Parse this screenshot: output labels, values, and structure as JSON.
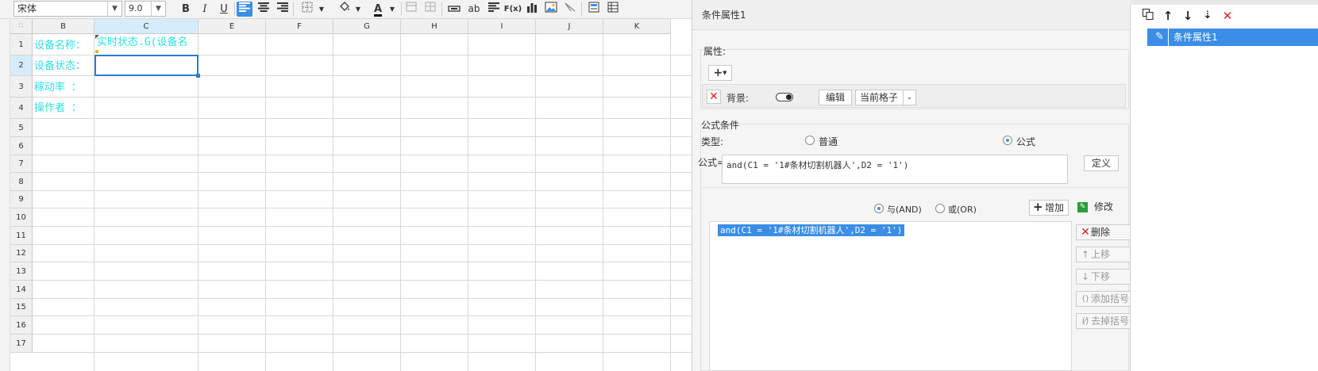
{
  "toolbar": {
    "font_family": "宋体",
    "font_size": "9.0",
    "bold": "B",
    "italic": "I",
    "underline": "U",
    "text_ab": "ab",
    "formula_btn": "F(x)"
  },
  "sheet": {
    "columns": [
      "B",
      "C",
      "E",
      "F",
      "G",
      "H",
      "I",
      "J",
      "K"
    ],
    "selected_column": "C",
    "rows": [
      "1",
      "2",
      "3",
      "4",
      "5",
      "6",
      "7",
      "8",
      "9",
      "10",
      "11",
      "12",
      "13",
      "14",
      "15",
      "16",
      "17"
    ],
    "selected_row": "2",
    "cells": {
      "b1": "设备名称：",
      "b2": "设备状态：",
      "b3": "稼动率 ：",
      "b4": "操作者 ：",
      "c1": "实时状态.G(设备名"
    }
  },
  "panel": {
    "title": "条件属性1",
    "attr_label": "属性:",
    "background_label": "背景:",
    "edit_label": "编辑",
    "scope_value": "当前格子",
    "formula_section": "公式条件",
    "type_label": "类型:",
    "type_normal": "普通",
    "type_formula": "公式",
    "formula_label": "公式=",
    "formula_value": "and(C1 = '1#条材切割机器人',D2 = '1')",
    "define_label": "定义",
    "and_label": "与(AND)",
    "or_label": "或(OR)",
    "add_label": "增加",
    "modify_label": "修改",
    "condition_item": "and(C1 = '1#条材切割机器人',D2 = '1')",
    "delete_label": "删除",
    "move_up_label": "上移",
    "move_down_label": "下移",
    "add_paren_label": "添加括号",
    "remove_paren_label": "去掉括号"
  },
  "list_panel": {
    "items": [
      "条件属性1"
    ]
  },
  "colors": {
    "accent": "#3a8ee6",
    "cell_text": "#2ee0e0",
    "delete_red": "#e02020",
    "add_green": "#2a9d3a"
  }
}
